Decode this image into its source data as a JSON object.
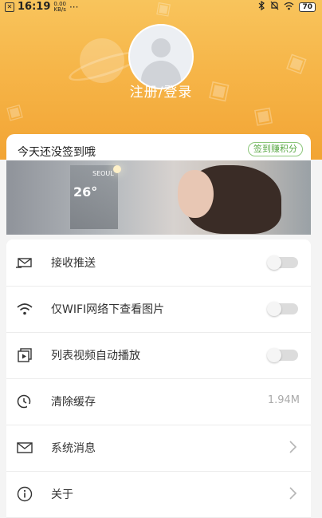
{
  "status_bar": {
    "time": "16:19",
    "speed_value": "0.00",
    "speed_unit": "KB/s",
    "dots": "···",
    "battery": "70"
  },
  "profile": {
    "login_label": "注册/登录"
  },
  "checkin": {
    "title": "今天还没签到哦",
    "button": "签到赚积分",
    "banner": {
      "city": "SEOUL",
      "temp": "26°"
    }
  },
  "settings": {
    "items": [
      {
        "label": "接收推送",
        "icon": "push-envelope-icon",
        "control": "toggle",
        "on": false
      },
      {
        "label": "仅WIFI网络下查看图片",
        "icon": "wifi-icon",
        "control": "toggle",
        "on": false
      },
      {
        "label": "列表视频自动播放",
        "icon": "video-play-icon",
        "control": "toggle",
        "on": false
      },
      {
        "label": "清除缓存",
        "icon": "clock-clean-icon",
        "control": "value",
        "value": "1.94M"
      },
      {
        "label": "系统消息",
        "icon": "mail-icon",
        "control": "chevron"
      },
      {
        "label": "关于",
        "icon": "info-icon",
        "control": "chevron"
      }
    ]
  },
  "colors": {
    "header_top": "#f8c45c",
    "header_bottom": "#f2a434",
    "accent_green": "#5aa845"
  }
}
